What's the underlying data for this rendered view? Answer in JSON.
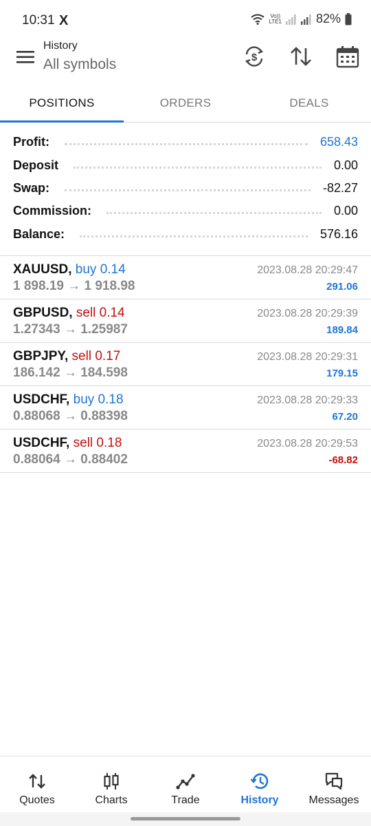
{
  "status_bar": {
    "time": "10:31",
    "x_logo": "X",
    "network_top": "Vo))",
    "network_bottom": "LTE1",
    "battery": "82%"
  },
  "header": {
    "title": "History",
    "subtitle": "All symbols",
    "menu_icon": "menu-icon",
    "actions": [
      "currency-sync-icon",
      "sort-icon",
      "calendar-icon"
    ]
  },
  "tabs": [
    "POSITIONS",
    "ORDERS",
    "DEALS"
  ],
  "active_tab": "POSITIONS",
  "summary": [
    {
      "label": "Profit:",
      "value": "658.43",
      "highlight": true
    },
    {
      "label": "Deposit",
      "value": "0.00",
      "highlight": false
    },
    {
      "label": "Swap:",
      "value": "-82.27",
      "highlight": false
    },
    {
      "label": "Commission:",
      "value": "0.00",
      "highlight": false
    },
    {
      "label": "Balance:",
      "value": "576.16",
      "highlight": false
    }
  ],
  "positions": [
    {
      "symbol": "XAUUSD,",
      "side": "buy 0.14",
      "direction": "buy",
      "prices": "1 898.19 → 1 918.98",
      "time": "2023.08.28 20:29:47",
      "profit": "291.06",
      "negative": false
    },
    {
      "symbol": "GBPUSD,",
      "side": "sell 0.14",
      "direction": "sell",
      "prices": "1.27343 → 1.25987",
      "time": "2023.08.28 20:29:39",
      "profit": "189.84",
      "negative": false
    },
    {
      "symbol": "GBPJPY,",
      "side": "sell 0.17",
      "direction": "sell",
      "prices": "186.142 → 184.598",
      "time": "2023.08.28 20:29:31",
      "profit": "179.15",
      "negative": false
    },
    {
      "symbol": "USDCHF,",
      "side": "buy 0.18",
      "direction": "buy",
      "prices": "0.88068 → 0.88398",
      "time": "2023.08.28 20:29:33",
      "profit": "67.20",
      "negative": false
    },
    {
      "symbol": "USDCHF,",
      "side": "sell 0.18",
      "direction": "sell",
      "prices": "0.88064 → 0.88402",
      "time": "2023.08.28 20:29:53",
      "profit": "-68.82",
      "negative": true
    }
  ],
  "bottom_nav": [
    {
      "label": "Quotes",
      "icon": "quotes-icon"
    },
    {
      "label": "Charts",
      "icon": "charts-icon"
    },
    {
      "label": "Trade",
      "icon": "trade-icon"
    },
    {
      "label": "History",
      "icon": "history-icon"
    },
    {
      "label": "Messages",
      "icon": "messages-icon"
    }
  ],
  "active_nav": "History",
  "colors": {
    "accent": "#1e74d6",
    "negative": "#c30f0f",
    "muted": "#888888"
  }
}
